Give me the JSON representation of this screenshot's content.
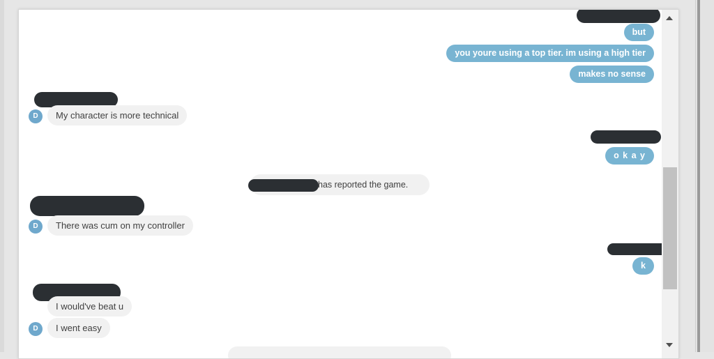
{
  "chat": {
    "messages": [
      {
        "sender": "me",
        "text": "but"
      },
      {
        "sender": "me",
        "text": "you youre using a top tier. im using a high tier"
      },
      {
        "sender": "me",
        "text": "makes no sense"
      },
      {
        "sender": "opponent",
        "avatar": "D",
        "text": "My character is more technical"
      },
      {
        "sender": "me",
        "text": "o k a y"
      },
      {
        "sender": "system",
        "text": "has reported the game."
      },
      {
        "sender": "opponent",
        "avatar": "D",
        "text": "There was cum on my controller"
      },
      {
        "sender": "me",
        "text": "k"
      },
      {
        "sender": "opponent",
        "text": "I would've beat u"
      },
      {
        "sender": "opponent",
        "avatar": "D",
        "text": "I went easy"
      }
    ]
  },
  "colors": {
    "outgoing_bubble": "#78b4d2",
    "incoming_bubble": "#f1f1f1",
    "avatar": "#6fa8cc",
    "redaction": "#2b2f33"
  },
  "icons": {
    "scroll_up": "triangle-up-icon",
    "scroll_down": "triangle-down-icon"
  }
}
